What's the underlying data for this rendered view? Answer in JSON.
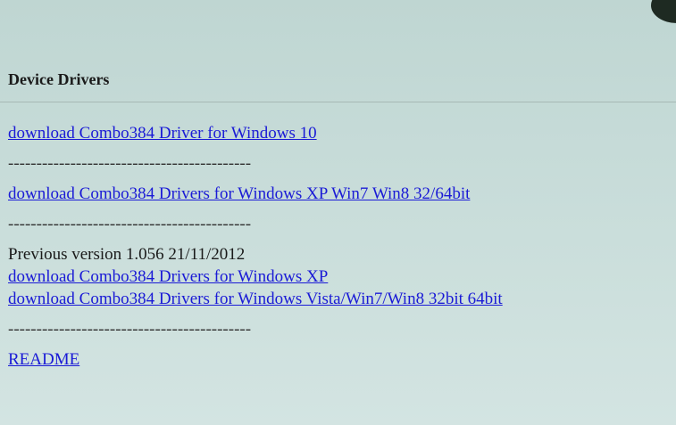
{
  "section": {
    "title": "Device Drivers"
  },
  "links": {
    "win10": "download  Combo384 Driver for Windows 10",
    "xp_win7_win8": "download  Combo384 Drivers for Windows XP Win7 Win8 32/64bit",
    "xp": "download  Combo384 Drivers for Windows XP",
    "vista_win7_win8": "download  Combo384 Drivers for Windows Vista/Win7/Win8 32bit 64bit",
    "readme": "README"
  },
  "separator": "-------------------------------------------",
  "previous_version": "Previous version 1.056 21/11/2012"
}
